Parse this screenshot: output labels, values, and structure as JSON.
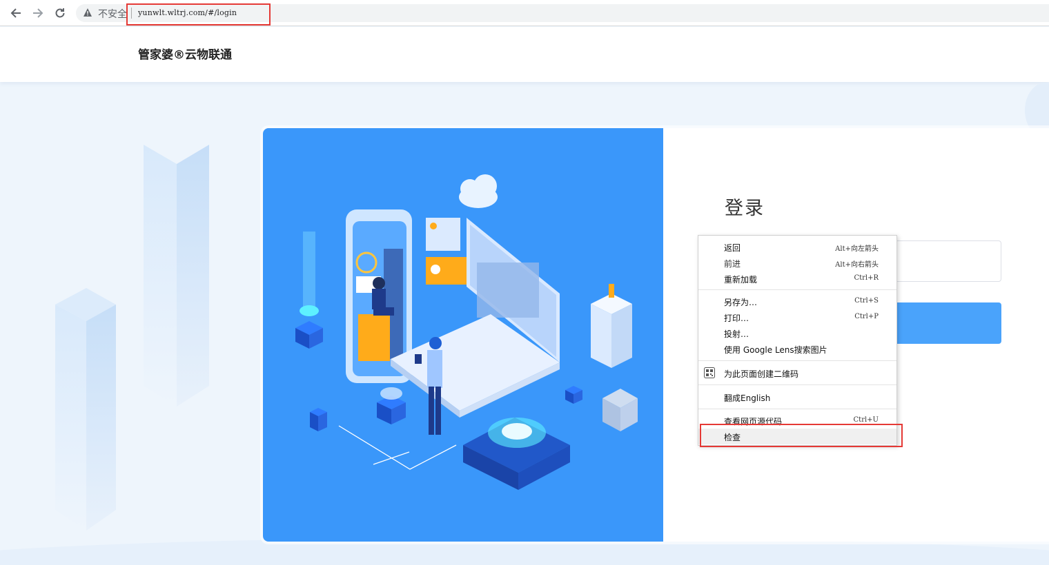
{
  "browser": {
    "insecure_label": "不安全",
    "url": "yunwlt.wltrj.com/#/login"
  },
  "site": {
    "brand": "管家婆®云物联通"
  },
  "login": {
    "title": "登录"
  },
  "context_menu": {
    "items": [
      {
        "label": "返回",
        "shortcut": "Alt+向左箭头"
      },
      {
        "label": "前进",
        "shortcut": "Alt+向右箭头"
      },
      {
        "label": "重新加载",
        "shortcut": "Ctrl+R"
      },
      {
        "label": "另存为…",
        "shortcut": "Ctrl+S"
      },
      {
        "label": "打印…",
        "shortcut": "Ctrl+P"
      },
      {
        "label": "投射…",
        "shortcut": ""
      },
      {
        "label": "使用 Google Lens搜索图片",
        "shortcut": ""
      },
      {
        "label": "为此页面创建二维码",
        "shortcut": ""
      },
      {
        "label": "翻成English",
        "shortcut": ""
      },
      {
        "label": "查看网页源代码",
        "shortcut": "Ctrl+U"
      },
      {
        "label": "检查",
        "shortcut": ""
      }
    ]
  },
  "colors": {
    "accent": "#3a97fa",
    "highlight": "#e53935"
  },
  "icons": {
    "back": "arrow-left-icon",
    "forward": "arrow-right-icon",
    "reload": "reload-icon",
    "warning": "warning-icon",
    "qr": "qr-code-icon"
  }
}
